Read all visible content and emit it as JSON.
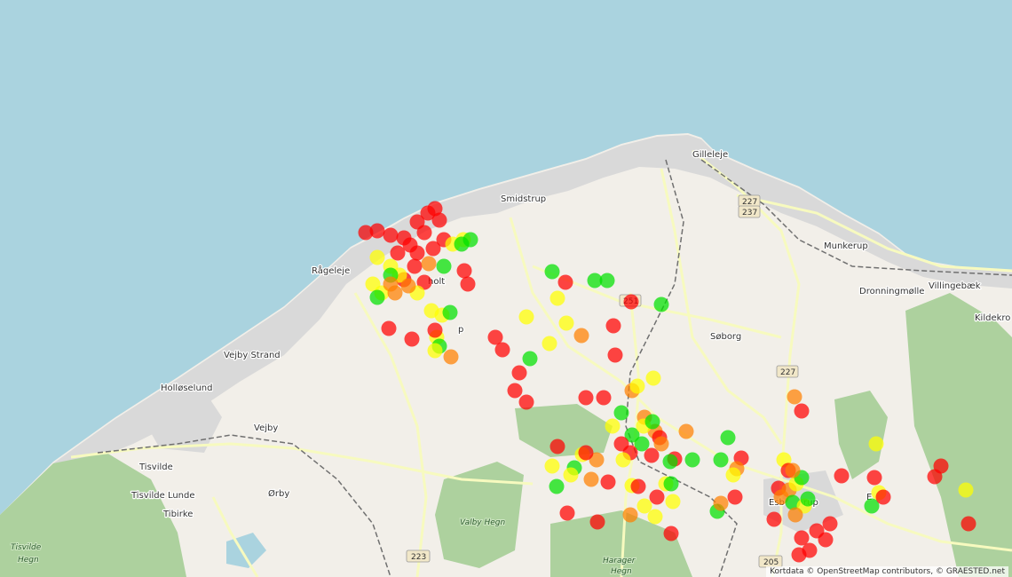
{
  "map": {
    "colors": {
      "sea": "#aad3df",
      "land": "#f2efe9",
      "forest": "#add19e",
      "urban": "#d9d9d9",
      "road_major": "#f7fabf",
      "rail": "#707070",
      "marker_red": "#ff0000",
      "marker_orange": "#ff7f00",
      "marker_yellow": "#ffff00",
      "marker_green": "#00e000"
    },
    "places": [
      {
        "id": "smidstrup",
        "name": "Smidstrup"
      },
      {
        "id": "gilleleje",
        "name": "Gilleleje"
      },
      {
        "id": "rageleje",
        "name": "Rågeleje"
      },
      {
        "id": "holt",
        "name": "holt"
      },
      {
        "id": "vejby-strand",
        "name": "Vejby Strand"
      },
      {
        "id": "hollose",
        "name": "Holløselund"
      },
      {
        "id": "vejby",
        "name": "Vejby"
      },
      {
        "id": "tisvilde",
        "name": "Tisvilde"
      },
      {
        "id": "tisvilde-lunde",
        "name": "Tisvilde Lunde"
      },
      {
        "id": "tibirke",
        "name": "Tibirke"
      },
      {
        "id": "orby",
        "name": "Ørby"
      },
      {
        "id": "soborg",
        "name": "Søborg"
      },
      {
        "id": "munkerup",
        "name": "Munkerup"
      },
      {
        "id": "dronningmolle",
        "name": "Dronningmølle"
      },
      {
        "id": "villingebaek",
        "name": "Villingebæk"
      },
      {
        "id": "kildekro",
        "name": "Kildekro"
      },
      {
        "id": "esbonderup",
        "name": "Esb"
      },
      {
        "id": "esbonderup-tail",
        "name": "rup"
      },
      {
        "id": "e",
        "name": "E"
      },
      {
        "id": "p-label",
        "name": "p"
      }
    ],
    "forest_labels": [
      {
        "id": "tisvilde-hegn-1",
        "name": "Tisvilde"
      },
      {
        "id": "tisvilde-hegn-2",
        "name": "Hegn"
      },
      {
        "id": "valby-hegn",
        "name": "Valby Hegn"
      },
      {
        "id": "harager-hegn-1",
        "name": "Harager"
      },
      {
        "id": "harager-hegn-2",
        "name": "Hegn"
      }
    ],
    "road_shields": [
      {
        "id": "r227a",
        "label": "227"
      },
      {
        "id": "r237",
        "label": "237"
      },
      {
        "id": "r251",
        "label": "251"
      },
      {
        "id": "r227b",
        "label": "227"
      },
      {
        "id": "r223",
        "label": "223"
      },
      {
        "id": "r205",
        "label": "205"
      }
    ],
    "attribution": "Kortdata © OpenStreetMap contributors, © GRAESTED.net"
  }
}
